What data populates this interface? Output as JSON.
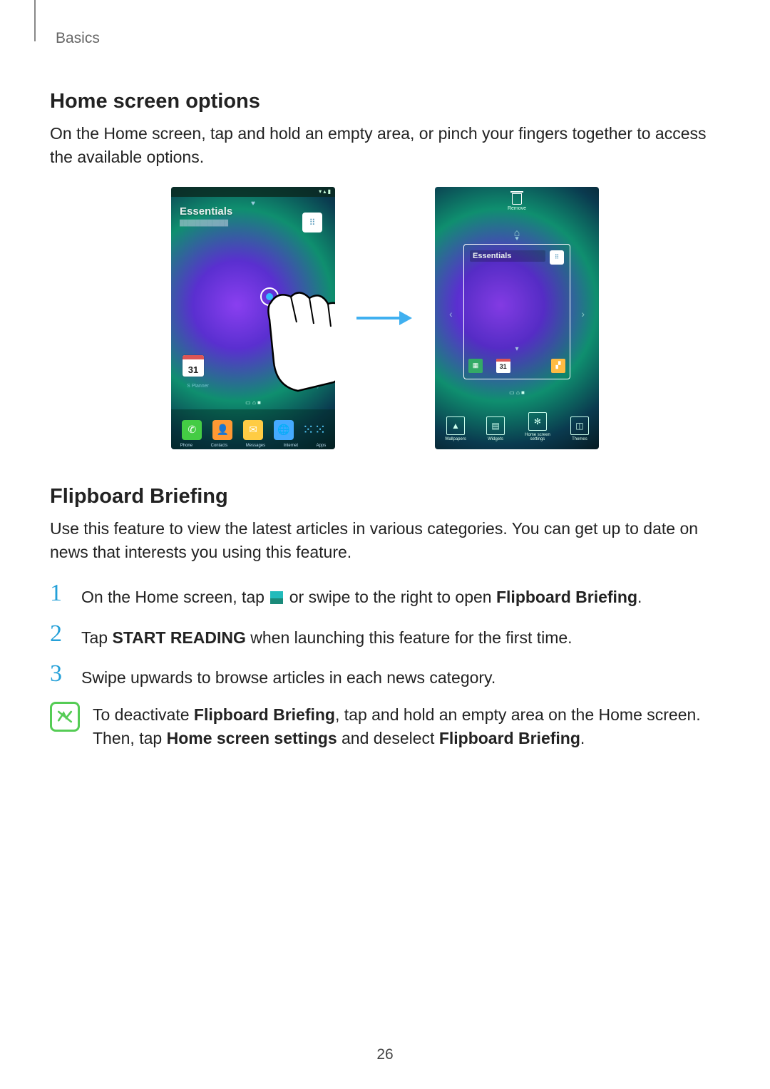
{
  "breadcrumb": "Basics",
  "section1": {
    "title": "Home screen options",
    "body": "On the Home screen, tap and hold an empty area, or pinch your fingers together to access the available options."
  },
  "phone1": {
    "essentials": "Essentials",
    "calendar_day": "31",
    "dock_labels": [
      "Phone",
      "Contacts",
      "Messages",
      "Internet",
      "Apps"
    ]
  },
  "phone2": {
    "remove_label": "Remove",
    "essentials": "Essentials",
    "calendar_day": "31",
    "options": [
      "Wallpapers",
      "Widgets",
      "Home screen\nsettings",
      "Themes"
    ]
  },
  "section2": {
    "title": "Flipboard Briefing",
    "body": "Use this feature to view the latest articles in various categories. You can get up to date on news that interests you using this feature."
  },
  "steps": {
    "s1_a": "On the Home screen, tap ",
    "s1_b": " or swipe to the right to open ",
    "s1_bold": "Flipboard Briefing",
    "s1_c": ".",
    "s2_a": "Tap ",
    "s2_bold": "START READING",
    "s2_b": " when launching this feature for the first time.",
    "s3": "Swipe upwards to browse articles in each news category."
  },
  "note": {
    "a": "To deactivate ",
    "b1": "Flipboard Briefing",
    "c": ", tap and hold an empty area on the Home screen. Then, tap ",
    "b2": "Home screen settings",
    "d": " and deselect ",
    "b3": "Flipboard Briefing",
    "e": "."
  },
  "page_number": "26"
}
